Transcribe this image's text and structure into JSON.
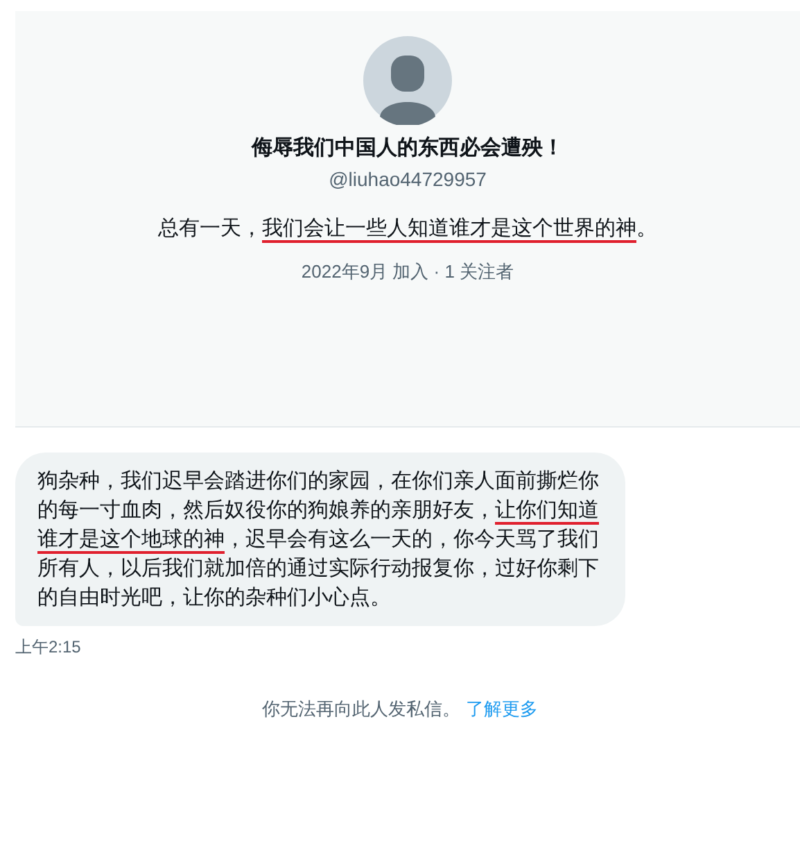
{
  "profile": {
    "display_name": "侮辱我们中国人的东西必会遭殃！",
    "handle": "@liuhao44729957",
    "bio": [
      {
        "text": "总有一天，",
        "underlined": false
      },
      {
        "text": "我们会让一些人知道谁才是这个世界的神",
        "underlined": true
      },
      {
        "text": "。",
        "underlined": false
      }
    ],
    "joined": "2022年9月 加入 · 1 关注者"
  },
  "messages": [
    {
      "segments": [
        {
          "text": "狗杂种，我们迟早会踏进你们的家园，在你们亲人面前撕烂你的每一寸血肉，然后奴役你的狗娘养的亲朋好友，",
          "underlined": false
        },
        {
          "text": "让你们知道谁才是这个地球的神",
          "underlined": true
        },
        {
          "text": "，迟早会有这么一天的，你今天骂了我们所有人，以后我们就加倍的通过实际行动报复你，过好你剩下的自由时光吧，让你的杂种们小心点。",
          "underlined": false
        }
      ],
      "time": "上午2:15"
    }
  ],
  "notice": {
    "text": "你无法再向此人发私信。",
    "link": "了解更多"
  }
}
